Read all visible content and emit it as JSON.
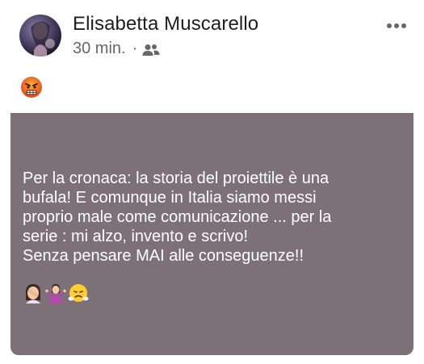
{
  "post": {
    "author": "Elisabetta Muscarello",
    "time": "30 min.",
    "separator": "·",
    "audience_icon": "friends-icon",
    "menu_icon": "more-options-icon",
    "header_emoji_icon": "angry-face-emoji",
    "text_lines": [
      "Per la cronaca: la storia del proiettile è una",
      "bufala! E comunque in Italia siamo messi",
      "proprio male come comunicazione ... per la",
      "serie : mi alzo, invento e scrivo!",
      "Senza pensare MAI alle conseguenze!!"
    ],
    "trailing_emoji_icons": [
      "woman-facepalming-emoji",
      "woman-shrugging-emoji",
      "face-with-steam-emoji"
    ],
    "background_color": "#7d7077"
  }
}
